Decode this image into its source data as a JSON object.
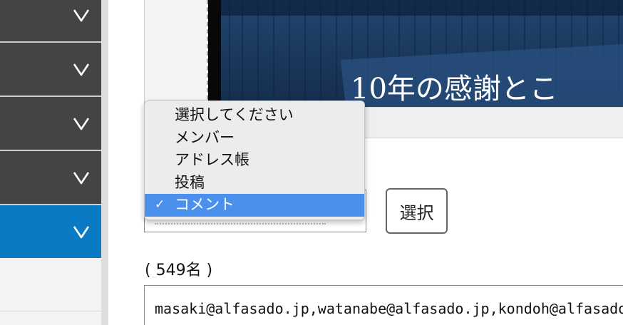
{
  "sidebar": {
    "items": [
      {
        "id": "menu-1",
        "state": "collapsed"
      },
      {
        "id": "menu-2",
        "state": "collapsed"
      },
      {
        "id": "menu-3",
        "state": "collapsed"
      },
      {
        "id": "menu-4",
        "state": "collapsed"
      },
      {
        "id": "menu-5",
        "state": "active"
      }
    ],
    "chevron_icon": "chevron-down-icon",
    "colors": {
      "item_bg": "#444444",
      "active_bg": "#0a7ac4",
      "chevron": "#ffffff"
    }
  },
  "preview": {
    "banner_text": "10年の感謝とこ",
    "banner_colors": {
      "curtain": "#1c3d66",
      "text": "#ffffff"
    }
  },
  "recipient_select": {
    "selected": "コメント",
    "options": [
      "選択してください",
      "メンバー",
      "アドレス帳",
      "投稿",
      "コメント"
    ],
    "check_icon": "checkmark-icon",
    "highlight_color": "#4a90ec"
  },
  "select_button_label": "選択",
  "count_label": "( 549名 )",
  "emails_value": "masaki@alfasado.jp,watanabe@alfasado.jp,kondoh@alfasado.jp"
}
